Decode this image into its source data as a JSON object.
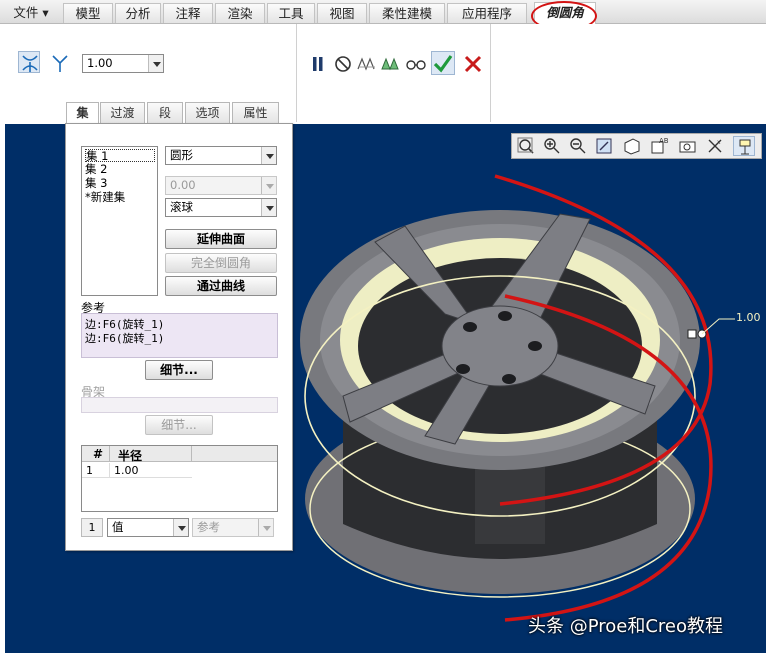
{
  "menu": {
    "file": "文件",
    "tabs": [
      "模型",
      "分析",
      "注释",
      "渲染",
      "工具",
      "视图",
      "柔性建模",
      "应用程序",
      "倒圆角"
    ]
  },
  "ribbon": {
    "radius_value": "1.00"
  },
  "sub_tabs": [
    "集",
    "过渡",
    "段",
    "选项",
    "属性"
  ],
  "panel": {
    "sets": [
      "集 1",
      "集 2",
      "集 3",
      "*新建集"
    ],
    "cross_section": "圆形",
    "distance_value": "0.00",
    "method": "滚球",
    "btn_extend": "延伸曲面",
    "btn_full_round": "完全倒圆角",
    "btn_through_curve": "通过曲线",
    "references_label": "参考",
    "references": [
      "边:F6(旋转_1)",
      "边:F6(旋转_1)"
    ],
    "details_label": "细节...",
    "skeleton_label": "骨架",
    "details2_label": "细节...",
    "table": {
      "headers": [
        "#",
        "半径"
      ],
      "rows": [
        [
          "1",
          "1.00"
        ]
      ]
    },
    "footer_num": "1",
    "footer_value": "值",
    "footer_ref": "参考"
  },
  "viewport": {
    "dimension_label": "1.00"
  },
  "watermark": "头条 @Proe和Creo教程",
  "colors": {
    "viewport_bg": "#002e67",
    "accent_red": "#d31414",
    "selection_blue": "#dde8f5"
  }
}
